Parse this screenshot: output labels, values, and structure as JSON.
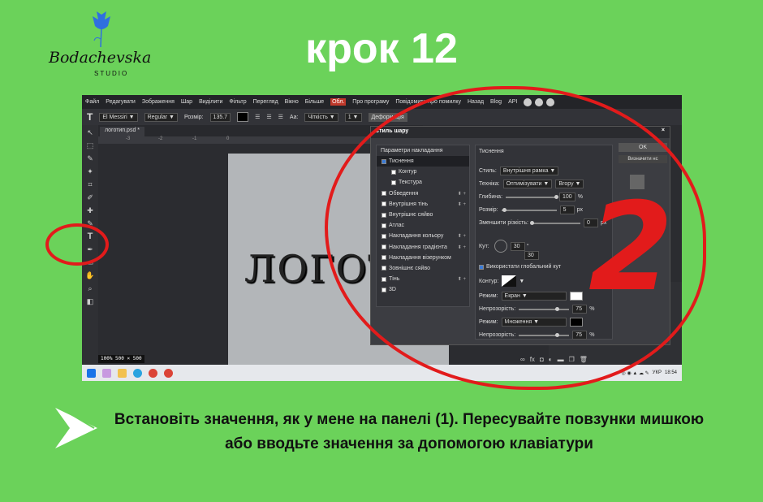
{
  "logo": {
    "name": "Bodachevska",
    "sub": "STUDIO"
  },
  "title": "крок 12",
  "menu": [
    "Файл",
    "Редагувати",
    "Зображення",
    "Шар",
    "Виділити",
    "Фільтр",
    "Перегляд",
    "Вікно",
    "Більше",
    "Обл.",
    "Про програму",
    "Повідомити про помилку",
    "Назад",
    "Blog",
    "API"
  ],
  "options": {
    "tool_icon": "T",
    "font": "El Messiri ▼",
    "style": "Regular ▼",
    "size_label": "Розмір:",
    "size_value": "135.7",
    "aa_label": "Aa:",
    "aa_value": "Чіткість ▼",
    "line_value": "1 ▼",
    "deform": "Деформація"
  },
  "doc_tab": "логотип.psd *",
  "ruler_ticks": [
    "-3",
    "-2",
    "-1",
    "0"
  ],
  "canvas_text": "ЛОГОТ",
  "zoom": "100%   500 × 500",
  "dialog": {
    "title": "Стиль шару",
    "close": "×",
    "left_header": "Параметри накладання",
    "items": [
      {
        "label": "Тиснення",
        "checked": true,
        "sub": false,
        "active": true,
        "plus": ""
      },
      {
        "label": "Контур",
        "checked": false,
        "sub": true,
        "active": false,
        "plus": ""
      },
      {
        "label": "Текстура",
        "checked": false,
        "sub": true,
        "active": false,
        "plus": ""
      },
      {
        "label": "Обведення",
        "checked": false,
        "sub": false,
        "active": false,
        "plus": "⬍ +"
      },
      {
        "label": "Внутрішня тінь",
        "checked": false,
        "sub": false,
        "active": false,
        "plus": "⬍ +"
      },
      {
        "label": "Внутрішнє сяйво",
        "checked": false,
        "sub": false,
        "active": false,
        "plus": ""
      },
      {
        "label": "Атлас",
        "checked": false,
        "sub": false,
        "active": false,
        "plus": ""
      },
      {
        "label": "Накладання кольору",
        "checked": false,
        "sub": false,
        "active": false,
        "plus": "⬍ +"
      },
      {
        "label": "Накладання градієнта",
        "checked": false,
        "sub": false,
        "active": false,
        "plus": "⬍ +"
      },
      {
        "label": "Накладання візерунком",
        "checked": false,
        "sub": false,
        "active": false,
        "plus": ""
      },
      {
        "label": "Зовнішнє сяйво",
        "checked": false,
        "sub": false,
        "active": false,
        "plus": ""
      },
      {
        "label": "Тінь",
        "checked": false,
        "sub": false,
        "active": false,
        "plus": "⬍ +"
      },
      {
        "label": "3D",
        "checked": false,
        "sub": false,
        "active": false,
        "plus": ""
      }
    ],
    "section": "Тиснення",
    "style_label": "Стиль:",
    "style_value": "Внутрішня рамка ▼",
    "technique_label": "Техніка:",
    "technique_value": "Оптимізувати ▼",
    "dir_value": "Вгору ▼",
    "depth_label": "Глибина:",
    "depth_value": "100",
    "depth_unit": "%",
    "depth_fill": 1.0,
    "size_label": "Розмір:",
    "size_value": "5",
    "size_unit": "px",
    "size_fill": 0.05,
    "soften_label": "Зменшити різкість:",
    "soften_value": "0",
    "soften_unit": "px",
    "soften_fill": 0.0,
    "angle_label": "Кут:",
    "angle_value": "30",
    "altitude_value": "30",
    "angle_unit": "°",
    "global_light": "Використати глобальний кут",
    "contour_label": "Контур:",
    "mode1_label": "Режим:",
    "mode1_value": "Екран ▼",
    "mode1_color": "#ffffff",
    "opacity1_label": "Непрозорість:",
    "opacity1_value": "75",
    "opacity1_unit": "%",
    "opacity1_fill": 0.75,
    "mode2_label": "Режим:",
    "mode2_value": "Множення ▼",
    "mode2_color": "#000000",
    "opacity2_label": "Непрозорість:",
    "opacity2_value": "75",
    "opacity2_unit": "%",
    "opacity2_fill": 0.75,
    "ok": "OK",
    "save": "Визначити нс"
  },
  "taskbar": {
    "lang": "УКР",
    "time": "18:54"
  },
  "annotation": "2",
  "instruction": "Встановіть значення, як у мене на панелі (1). Пересувайте повзунки мишкою або вводьте значення за допомогою клавіатури",
  "colors": {
    "bg": "#6bd25a",
    "ring": "#e21b1b"
  }
}
